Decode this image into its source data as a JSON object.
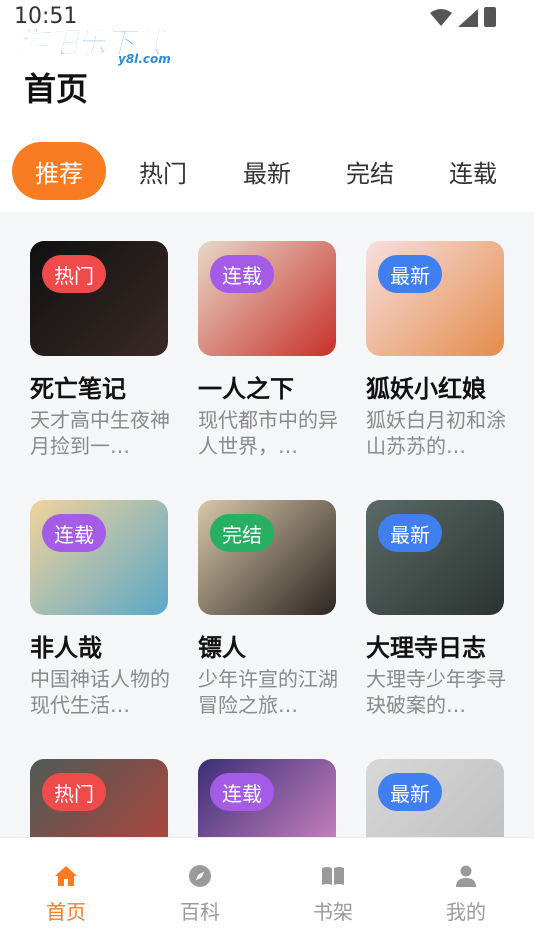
{
  "status_bar": {
    "time": "10:51"
  },
  "watermark": {
    "main": "游吧乐下载",
    "sub": "y8l.com"
  },
  "header": {
    "title": "首页"
  },
  "tabs": [
    {
      "label": "推荐",
      "active": true
    },
    {
      "label": "热门",
      "active": false
    },
    {
      "label": "最新",
      "active": false
    },
    {
      "label": "完结",
      "active": false
    },
    {
      "label": "连载",
      "active": false
    }
  ],
  "badge_colors": {
    "热门": "#f04b4b",
    "连载": "#a45ce6",
    "最新": "#3f7ff0",
    "完结": "#27b064"
  },
  "cards": [
    {
      "title": "死亡笔记",
      "desc": "天才高中生夜神月捡到一…",
      "badge": "热门",
      "cover_colors": [
        "#101010",
        "#3a2a26"
      ]
    },
    {
      "title": "一人之下",
      "desc": "现代都市中的异人世界，…",
      "badge": "连载",
      "cover_colors": [
        "#e7d9c9",
        "#c8302a"
      ]
    },
    {
      "title": "狐妖小红娘",
      "desc": "狐妖白月初和涂山苏苏的…",
      "badge": "最新",
      "cover_colors": [
        "#f6dfe0",
        "#e58c4a"
      ]
    },
    {
      "title": "非人哉",
      "desc": "中国神话人物的现代生活…",
      "badge": "连载",
      "cover_colors": [
        "#f1d39b",
        "#5aa7c8"
      ]
    },
    {
      "title": "镖人",
      "desc": "少年许宣的江湖冒险之旅…",
      "badge": "完结",
      "cover_colors": [
        "#d7c8aa",
        "#2c2520"
      ]
    },
    {
      "title": "大理寺日志",
      "desc": "大理寺少年李寻玦破案的…",
      "badge": "最新",
      "cover_colors": [
        "#5a6a66",
        "#2b3330"
      ]
    },
    {
      "title": "",
      "desc": "",
      "badge": "热门",
      "cover_colors": [
        "#4e5a55",
        "#b9433a"
      ]
    },
    {
      "title": "",
      "desc": "",
      "badge": "连载",
      "cover_colors": [
        "#3b2e77",
        "#d98bc6"
      ]
    },
    {
      "title": "",
      "desc": "",
      "badge": "最新",
      "cover_colors": [
        "#d8d8d8",
        "#bdbdbd"
      ]
    }
  ],
  "bottom_nav": [
    {
      "label": "首页",
      "icon": "home-icon",
      "active": true
    },
    {
      "label": "百科",
      "icon": "compass-icon",
      "active": false
    },
    {
      "label": "书架",
      "icon": "book-icon",
      "active": false
    },
    {
      "label": "我的",
      "icon": "user-icon",
      "active": false
    }
  ],
  "colors": {
    "accent": "#fa7c22",
    "inactive": "#9a9a9a"
  }
}
